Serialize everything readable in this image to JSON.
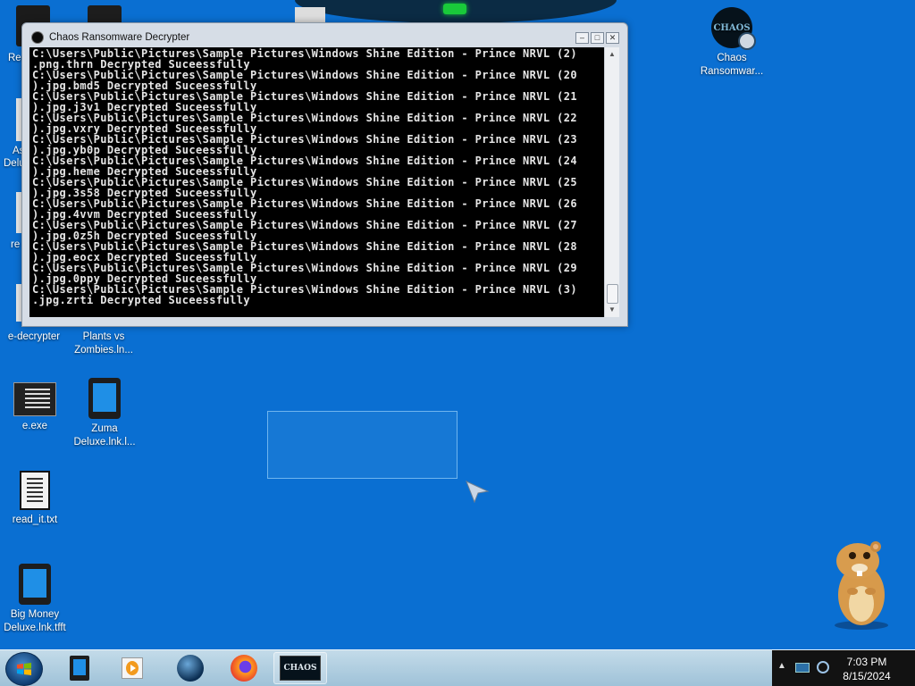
{
  "window": {
    "title": "Chaos Ransomware Decrypter",
    "console_lines": [
      "C:\\Users\\Public\\Pictures\\Sample Pictures\\Windows Shine Edition - Prince NRVL (2)",
      ".png.thrn Decrypted Suceessfully",
      "C:\\Users\\Public\\Pictures\\Sample Pictures\\Windows Shine Edition - Prince NRVL (20",
      ").jpg.bmd5 Decrypted Suceessfully",
      "C:\\Users\\Public\\Pictures\\Sample Pictures\\Windows Shine Edition - Prince NRVL (21",
      ").jpg.j3v1 Decrypted Suceessfully",
      "C:\\Users\\Public\\Pictures\\Sample Pictures\\Windows Shine Edition - Prince NRVL (22",
      ").jpg.vxry Decrypted Suceessfully",
      "C:\\Users\\Public\\Pictures\\Sample Pictures\\Windows Shine Edition - Prince NRVL (23",
      ").jpg.yb0p Decrypted Suceessfully",
      "C:\\Users\\Public\\Pictures\\Sample Pictures\\Windows Shine Edition - Prince NRVL (24",
      ").jpg.heme Decrypted Suceessfully",
      "C:\\Users\\Public\\Pictures\\Sample Pictures\\Windows Shine Edition - Prince NRVL (25",
      ").jpg.3s58 Decrypted Suceessfully",
      "C:\\Users\\Public\\Pictures\\Sample Pictures\\Windows Shine Edition - Prince NRVL (26",
      ").jpg.4vvm Decrypted Suceessfully",
      "C:\\Users\\Public\\Pictures\\Sample Pictures\\Windows Shine Edition - Prince NRVL (27",
      ").jpg.0z5h Decrypted Suceessfully",
      "C:\\Users\\Public\\Pictures\\Sample Pictures\\Windows Shine Edition - Prince NRVL (28",
      ").jpg.eocx Decrypted Suceessfully",
      "C:\\Users\\Public\\Pictures\\Sample Pictures\\Windows Shine Edition - Prince NRVL (29",
      ").jpg.0ppy Decrypted Suceessfully",
      "C:\\Users\\Public\\Pictures\\Sample Pictures\\Windows Shine Edition - Prince NRVL (3)",
      ".jpg.zrti Decrypted Suceessfully"
    ]
  },
  "desktop_icons": {
    "chaos": {
      "label_line1": "Chaos",
      "label_line2": "Ransomwar...",
      "logo_text": "CHAOS"
    },
    "decrypter": {
      "label": "e-decrypter"
    },
    "plants": {
      "label_line1": "Plants vs",
      "label_line2": "Zombies.ln..."
    },
    "exe": {
      "label": "e.exe"
    },
    "zuma": {
      "label_line1": "Zuma",
      "label_line2": "Deluxe.lnk.l..."
    },
    "readit": {
      "label": "read_it.txt"
    },
    "bigmoney": {
      "label_line1": "Big Money",
      "label_line2": "Deluxe.lnk.tfft"
    },
    "partial_labels": [
      "Rec",
      "As",
      "Delu",
      "re"
    ]
  },
  "taskbar": {
    "chaos_button_text": "CHAOS",
    "clock_time": "7:03 PM",
    "clock_date": "8/15/2024"
  },
  "colors": {
    "desktop": "#0a6fd2",
    "console_bg": "#000000",
    "console_text": "#e6e6e6"
  }
}
